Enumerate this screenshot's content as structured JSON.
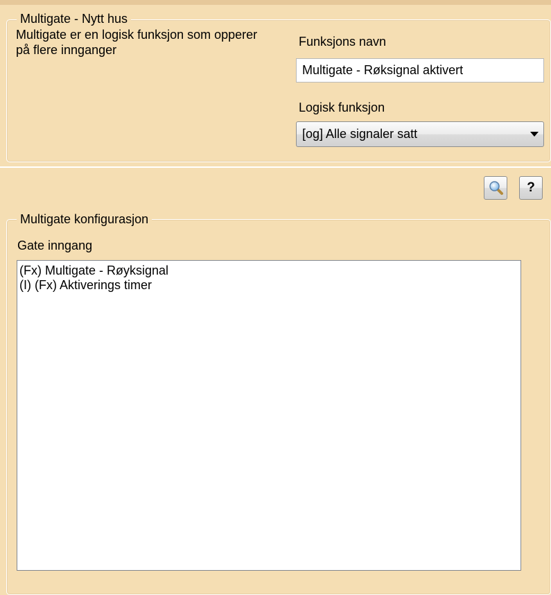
{
  "header": {
    "group_title": "Multigate - Nytt hus",
    "description": "Multigate er en logisk funksjon som opperer på flere innganger"
  },
  "function_name": {
    "label": "Funksjons navn",
    "value": "Multigate - Røksignal aktivert"
  },
  "logic_function": {
    "label": "Logisk funksjon",
    "selected": "[og] Alle signaler satt"
  },
  "toolbar": {
    "search_icon": "magnifier-icon",
    "help_label": "?"
  },
  "config": {
    "group_title": "Multigate konfigurasjon",
    "gate_input_label": "Gate inngang",
    "items": [
      "(Fx) Multigate - Røyksignal",
      "(I) (Fx) Aktiverings timer"
    ]
  },
  "colors": {
    "background": "#f5deb3",
    "border_highlight": "#ffffff"
  }
}
